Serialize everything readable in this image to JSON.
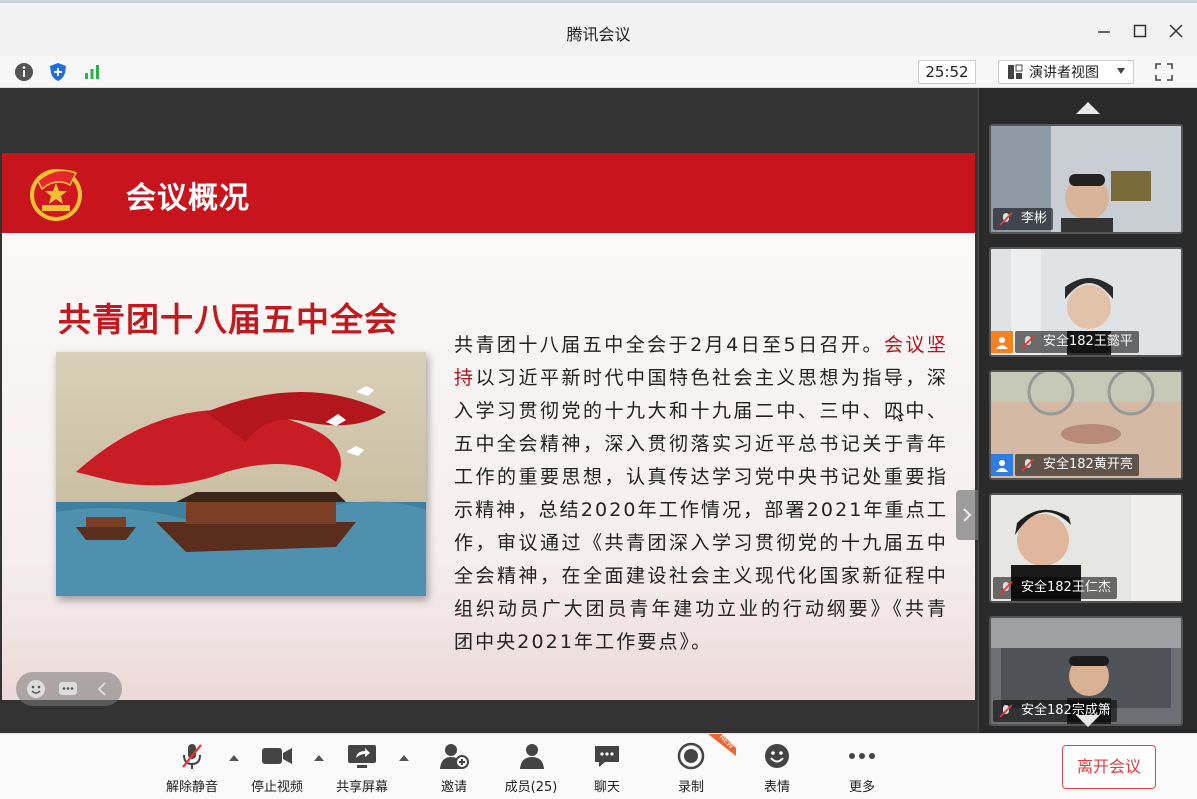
{
  "window": {
    "title": "腾讯会议",
    "minimize_icon": "minimize-icon",
    "maximize_icon": "maximize-icon",
    "close_icon": "close-icon"
  },
  "toolbar": {
    "timer": "25:52",
    "view_mode": "演讲者视图",
    "icons": [
      "info-icon",
      "shield-icon",
      "signal-icon",
      "fullscreen-icon"
    ]
  },
  "slide": {
    "banner_title": "会议概况",
    "heading": "共青团十八届五中全会",
    "para_part1": "共青团十八届五中全会于2月4日至5日召开。",
    "para_highlight": "会议坚持",
    "para_part2": "以习近平新时代中国特色社会主义思想为指导，深入学习贯彻党的十九大和十九届二中、三中、四中、五中全会精神，深入贯彻落实习近平总书记关于青年工作的重要思想，认真传达学习党中央书记处重要指示精神，总结2020年工作情况，部署2021年重点工作，审议通过《共青团深入学习贯彻党的十九届五中全会精神，在全面建设社会主义现代化国家新征程中组织动员广大团员青年建功立业的行动纲要》《共青团中央2021年工作要点》。",
    "highlight_color": "#b5121b",
    "banner_color": "#c8141c"
  },
  "participants": [
    {
      "name": "李彬",
      "role_badge": ""
    },
    {
      "name": "安全182王懿平",
      "role_badge": "host"
    },
    {
      "name": "安全182黄开亮",
      "role_badge": "cohost"
    },
    {
      "name": "安全182王仁杰",
      "role_badge": ""
    },
    {
      "name": "安全182宗成箫",
      "role_badge": ""
    }
  ],
  "controls": {
    "unmute": "解除静音",
    "stop_video": "停止视频",
    "share_screen": "共享屏幕",
    "invite": "邀请",
    "members": "成员(25)",
    "chat": "聊天",
    "record": "录制",
    "record_badge": "NEW",
    "reactions": "表情",
    "more": "更多",
    "leave": "离开会议"
  }
}
